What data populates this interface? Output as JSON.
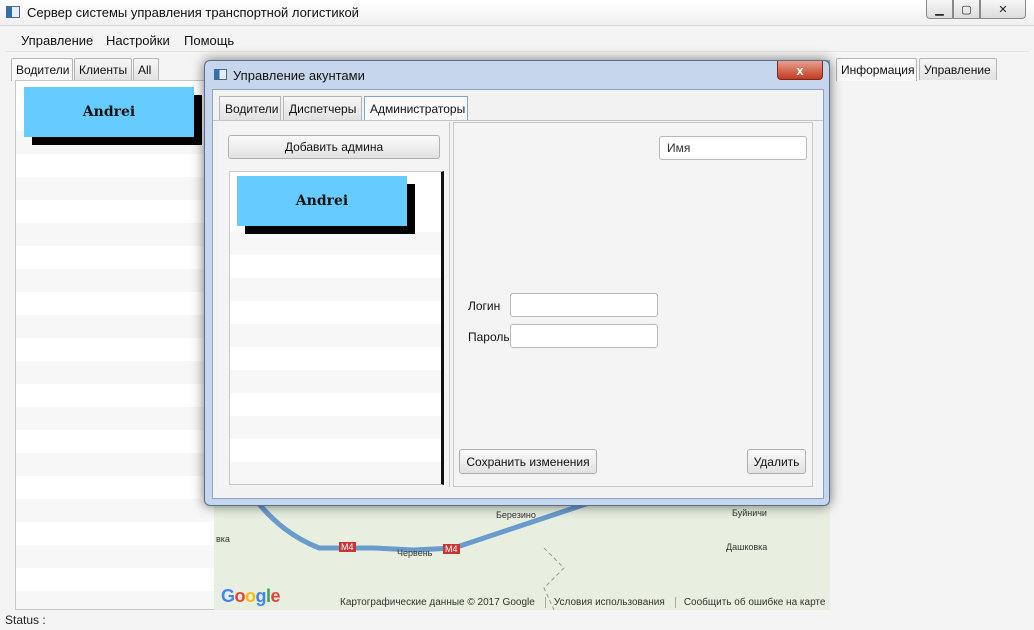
{
  "window": {
    "title": "Сервер системы управления транспортной логистикой"
  },
  "menu": [
    "Управление",
    "Настройки",
    "Помощь"
  ],
  "left_tabs": [
    "Водители",
    "Клиенты",
    "All"
  ],
  "left_list": {
    "cards": [
      "Andrei"
    ]
  },
  "right_tabs": [
    "Информация",
    "Управление"
  ],
  "map": {
    "labels": [
      "Березино",
      "Буйничи",
      "Дашковка",
      "Червень",
      "вка",
      "M4",
      "M4"
    ],
    "footer": [
      "Картографические данные © 2017 Google",
      "Условия использования",
      "Сообщить об ошибке на карте"
    ],
    "logo": "Google"
  },
  "status": {
    "label": "Status :"
  },
  "dialog": {
    "title": "Управление акунтами",
    "close_label": "x",
    "tabs": [
      "Водители",
      "Диспетчеры",
      "Администраторы"
    ],
    "add_button": "Добавить админа",
    "cards": [
      "Andrei"
    ],
    "name_field": {
      "value": "Имя"
    },
    "login_label": "Логин",
    "login_value": "",
    "password_label": "Пароль",
    "password_value": "",
    "save_button": "Сохранить изменения",
    "delete_button": "Удалить"
  },
  "colors": {
    "card": "#66ccff",
    "dialog_frame": "#c6d6ec"
  }
}
